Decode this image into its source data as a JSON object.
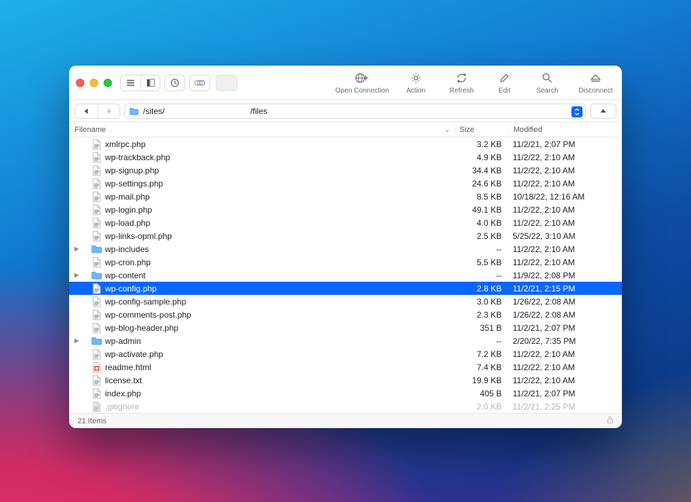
{
  "toolbar": {
    "open_connection": "Open Connection",
    "action": "Action",
    "refresh": "Refresh",
    "edit": "Edit",
    "search": "Search",
    "disconnect": "Disconnect"
  },
  "path": {
    "prefix": "/sites/",
    "suffix": "/files"
  },
  "columns": {
    "filename": "Filename",
    "size": "Size",
    "modified": "Modified"
  },
  "files": [
    {
      "name": "xmlrpc.php",
      "type": "file",
      "size": "3.2 KB",
      "modified": "11/2/21, 2:07 PM"
    },
    {
      "name": "wp-trackback.php",
      "type": "file",
      "size": "4.9 KB",
      "modified": "11/2/22, 2:10 AM"
    },
    {
      "name": "wp-signup.php",
      "type": "file",
      "size": "34.4 KB",
      "modified": "11/2/22, 2:10 AM"
    },
    {
      "name": "wp-settings.php",
      "type": "file",
      "size": "24.6 KB",
      "modified": "11/2/22, 2:10 AM"
    },
    {
      "name": "wp-mail.php",
      "type": "file",
      "size": "8.5 KB",
      "modified": "10/18/22, 12:16 AM"
    },
    {
      "name": "wp-login.php",
      "type": "file",
      "size": "49.1 KB",
      "modified": "11/2/22, 2:10 AM"
    },
    {
      "name": "wp-load.php",
      "type": "file",
      "size": "4.0 KB",
      "modified": "11/2/22, 2:10 AM"
    },
    {
      "name": "wp-links-opml.php",
      "type": "file",
      "size": "2.5 KB",
      "modified": "5/25/22, 3:10 AM"
    },
    {
      "name": "wp-includes",
      "type": "folder",
      "size": "--",
      "modified": "11/2/22, 2:10 AM",
      "expandable": true
    },
    {
      "name": "wp-cron.php",
      "type": "file",
      "size": "5.5 KB",
      "modified": "11/2/22, 2:10 AM"
    },
    {
      "name": "wp-content",
      "type": "folder",
      "size": "--",
      "modified": "11/9/22, 2:08 PM",
      "expandable": true
    },
    {
      "name": "wp-config.php",
      "type": "file",
      "size": "2.8 KB",
      "modified": "11/2/21, 2:15 PM",
      "selected": true
    },
    {
      "name": "wp-config-sample.php",
      "type": "file",
      "size": "3.0 KB",
      "modified": "1/26/22, 2:08 AM"
    },
    {
      "name": "wp-comments-post.php",
      "type": "file",
      "size": "2.3 KB",
      "modified": "1/26/22, 2:08 AM"
    },
    {
      "name": "wp-blog-header.php",
      "type": "file",
      "size": "351 B",
      "modified": "11/2/21, 2:07 PM"
    },
    {
      "name": "wp-admin",
      "type": "folder",
      "size": "--",
      "modified": "2/20/22, 7:35 PM",
      "expandable": true
    },
    {
      "name": "wp-activate.php",
      "type": "file",
      "size": "7.2 KB",
      "modified": "11/2/22, 2:10 AM"
    },
    {
      "name": "readme.html",
      "type": "html",
      "size": "7.4 KB",
      "modified": "11/2/22, 2:10 AM"
    },
    {
      "name": "license.txt",
      "type": "file",
      "size": "19.9 KB",
      "modified": "11/2/22, 2:10 AM"
    },
    {
      "name": "index.php",
      "type": "file",
      "size": "405 B",
      "modified": "11/2/21, 2:07 PM"
    },
    {
      "name": ".gitignore",
      "type": "file",
      "size": "2.0 KB",
      "modified": "11/2/21, 2:25 PM",
      "dimmed": true
    }
  ],
  "status": {
    "count": "21 Items"
  }
}
